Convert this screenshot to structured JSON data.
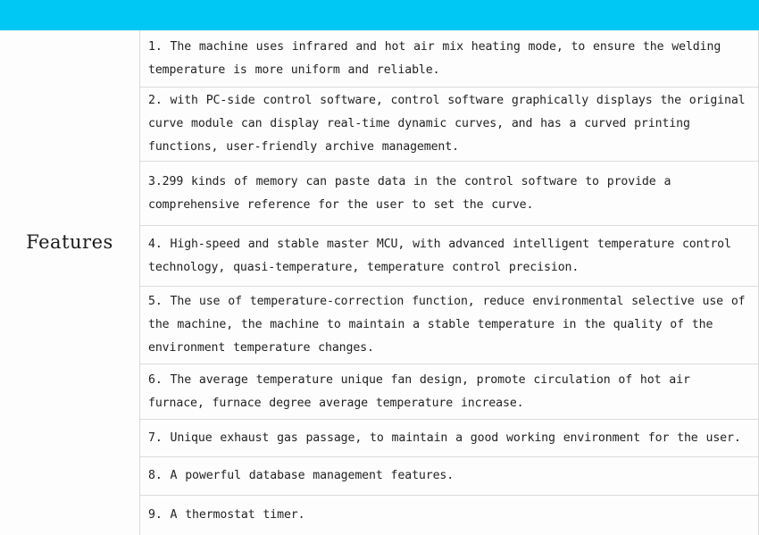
{
  "banner": {
    "name": "top-banner",
    "color": "#00c8f5",
    "text": ""
  },
  "table": {
    "row_label": "Features",
    "border_color": "#dcdcdc",
    "background_color": "#fdfdfd",
    "text_color": "#222222",
    "features": [
      {
        "number": "1.",
        "text": "1. The machine uses infrared and hot air mix heating mode, to ensure the welding temperature is more uniform and reliable."
      },
      {
        "number": "2.",
        "text": "2. with PC-side control software, control software graphically displays the original curve module can display real-time dynamic curves, and has a curved printing functions, user-friendly archive management."
      },
      {
        "number": "3.",
        "text": "3.299 kinds of memory can paste data in the control software to provide a comprehensive reference for the user to set the curve."
      },
      {
        "number": "4.",
        "text": "4. High-speed and stable master MCU, with advanced intelligent temperature control technology, quasi-temperature, temperature control precision."
      },
      {
        "number": "5.",
        "text": "5. The use of temperature-correction function, reduce environmental selective use of the machine, the machine to maintain a stable temperature in the quality of the environment temperature changes."
      },
      {
        "number": "6.",
        "text": "6. The average temperature unique fan design, promote circulation of hot air furnace, furnace degree average temperature increase."
      },
      {
        "number": "7.",
        "text": "7. Unique exhaust gas passage, to maintain a good working environment for the user."
      },
      {
        "number": "8.",
        "text": "8. A powerful database management features."
      },
      {
        "number": "9.",
        "text": "9. A thermostat timer."
      }
    ]
  }
}
